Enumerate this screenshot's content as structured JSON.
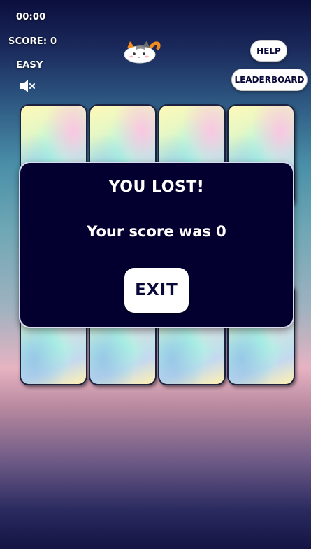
{
  "hud": {
    "timer": "00:00",
    "score_label": "SCORE: 0",
    "difficulty": "EASY",
    "sound_icon": "speaker-muted-icon"
  },
  "mascot_icon": "cat-mascot-icon",
  "header_buttons": {
    "help_label": "HELP",
    "leaderboard_label": "LEADERBOARD"
  },
  "board": {
    "rows": 2,
    "columns": 4,
    "card_back": "iridescent-pastel"
  },
  "modal": {
    "title": "YOU LOST!",
    "message": "Your score was 0",
    "exit_label": "EXIT"
  },
  "colors": {
    "modal_background": "#03002f",
    "button_text": "#0a0a3a"
  }
}
